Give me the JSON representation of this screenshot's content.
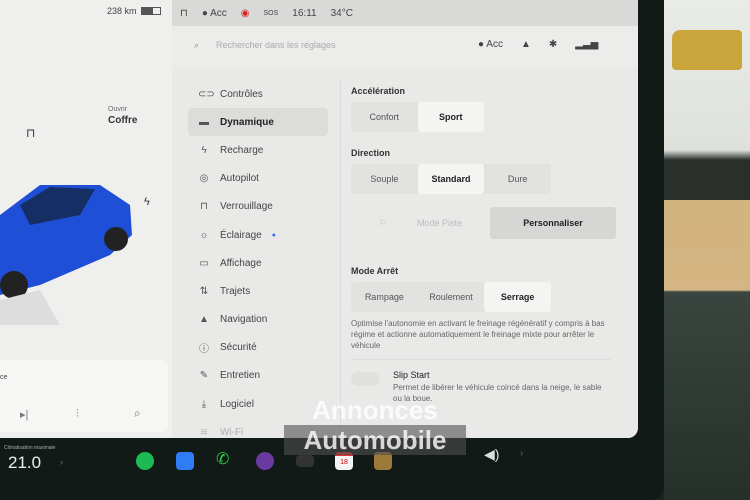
{
  "status": {
    "range": "238 km",
    "battery_level": 0.6,
    "profile": "Acc",
    "time": "16:11",
    "temperature": "34°C",
    "sos": "SOS"
  },
  "left": {
    "trunk_label": "Ouvrir",
    "trunk_action": "Coffre",
    "media_text": "ce",
    "car_color": "#1f4fd6"
  },
  "search": {
    "placeholder": "Rechercher dans les réglages",
    "profile": "Acc"
  },
  "nav": [
    {
      "icon": "toggle-icon",
      "glyph": "⊂⊃",
      "label": "Contrôles"
    },
    {
      "icon": "car-icon",
      "glyph": "🚘",
      "label": "Dynamique",
      "active": true
    },
    {
      "icon": "bolt-icon",
      "glyph": "⚡",
      "label": "Recharge"
    },
    {
      "icon": "steering-icon",
      "glyph": "◎",
      "label": "Autopilot"
    },
    {
      "icon": "lock-icon",
      "glyph": "🔒",
      "label": "Verrouillage"
    },
    {
      "icon": "light-icon",
      "glyph": "☼",
      "label": "Éclairage"
    },
    {
      "icon": "display-icon",
      "glyph": "▭",
      "label": "Affichage"
    },
    {
      "icon": "route-icon",
      "glyph": "⇅",
      "label": "Trajets"
    },
    {
      "icon": "navigation-icon",
      "glyph": "▲",
      "label": "Navigation"
    },
    {
      "icon": "safety-icon",
      "glyph": "ⓘ",
      "label": "Sécurité"
    },
    {
      "icon": "wrench-icon",
      "glyph": "✎",
      "label": "Entretien"
    },
    {
      "icon": "download-icon",
      "glyph": "⤓",
      "label": "Logiciel"
    },
    {
      "icon": "wifi-icon",
      "glyph": "≋",
      "label": "Wi-Fi"
    }
  ],
  "content": {
    "acceleration": {
      "label": "Accélération",
      "options": [
        "Confort",
        "Sport"
      ],
      "selected": 1
    },
    "direction": {
      "label": "Direction",
      "options": [
        "Souple",
        "Standard",
        "Dure"
      ],
      "selected": 1
    },
    "track_mode": "Mode Piste",
    "customize": "Personnaliser",
    "stop_mode": {
      "label": "Mode Arrêt",
      "options": [
        "Rampage",
        "Roulement",
        "Serrage"
      ],
      "selected": 2,
      "description": "Optimise l'autonomie en activant le freinage régénératif y compris à bas régime et actionne automatiquement le freinage mixte pour arrêter le véhicule"
    },
    "slip_start": {
      "label": "Slip Start",
      "description": "Permet de libérer le véhicule coincé dans la neige, le sable ou la boue."
    }
  },
  "dock": {
    "climate_label": "Climatisation maximale",
    "temperature": "21.0",
    "calendar_day": "18"
  },
  "watermark": [
    "Annonces",
    "Automobile"
  ]
}
